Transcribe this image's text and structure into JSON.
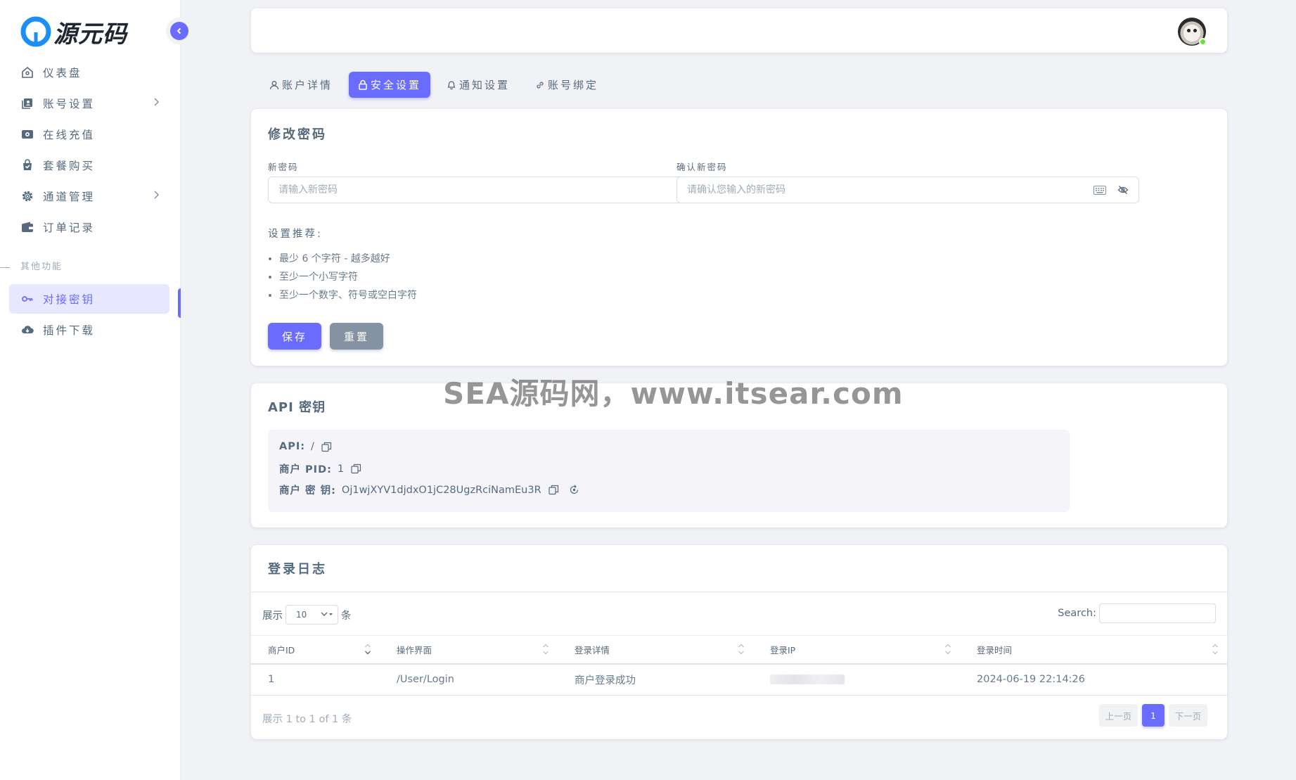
{
  "brand": {
    "name": "源元码",
    "accent": "#696cff",
    "logo_color": "#1b8ff5"
  },
  "sidebar": {
    "items": [
      {
        "label": "仪表盘",
        "icon": "home-icon"
      },
      {
        "label": "账号设置",
        "icon": "user-card-icon"
      },
      {
        "label": "在线充值",
        "icon": "money-icon"
      },
      {
        "label": "套餐购买",
        "icon": "bag-icon"
      },
      {
        "label": "通道管理",
        "icon": "gear-icon"
      },
      {
        "label": "订单记录",
        "icon": "wallet-icon"
      }
    ],
    "section_header": "其他功能",
    "extra_items": [
      {
        "label": "对接密钥",
        "icon": "key-icon",
        "active": true
      },
      {
        "label": "插件下载",
        "icon": "cloud-download-icon"
      }
    ]
  },
  "tabs": [
    {
      "label": "账户详情",
      "icon": "user-icon"
    },
    {
      "label": "安全设置",
      "icon": "lock-icon",
      "active": true
    },
    {
      "label": "通知设置",
      "icon": "bell-icon"
    },
    {
      "label": "账号绑定",
      "icon": "link-icon"
    }
  ],
  "password_card": {
    "title": "修改密码",
    "new_label": "新密码",
    "new_placeholder": "请输入新密码",
    "confirm_label": "确认新密码",
    "confirm_placeholder": "请确认您输入的新密码",
    "rec_title": "设置推荐:",
    "recommendations": [
      "最少 6 个字符 - 越多越好",
      "至少一个小写字符",
      "至少一个数字、符号或空白字符"
    ],
    "save": "保存",
    "reset": "重置"
  },
  "api_card": {
    "title": "API 密钥",
    "api_label": "API:",
    "api_value": "/",
    "pid_label": "商户 PID:",
    "pid_value": "1",
    "key_label": "商户 密 钥:",
    "key_value": "Oj1wjXYV1djdxO1jC28UgzRciNamEu3R"
  },
  "log_card": {
    "title": "登录日志",
    "show": "展示",
    "page_len": "10",
    "unit": "条",
    "search_label": "Search:",
    "columns": [
      "商户ID",
      "操作界面",
      "登录详情",
      "登录IP",
      "登录时间"
    ],
    "rows": [
      {
        "id": "1",
        "page": "/User/Login",
        "detail": "商户登录成功",
        "ip": "",
        "time": "2024-06-19 22:14:26"
      }
    ],
    "info": "展示 1 to 1 of 1 条",
    "prev": "上一页",
    "page": "1",
    "next": "下一页"
  },
  "watermark": "SEA源码网，www.itsear.com"
}
